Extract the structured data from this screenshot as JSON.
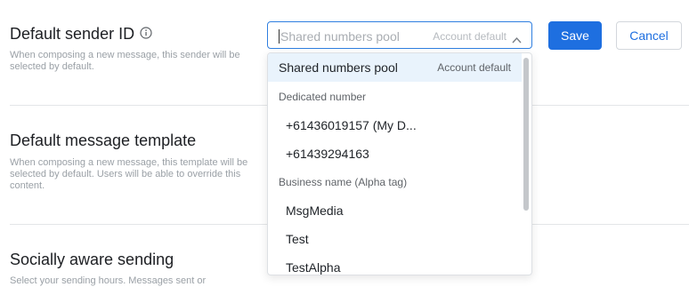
{
  "sender": {
    "title": "Default sender ID",
    "description": "When composing a new message, this sender will be selected by default.",
    "select_value": "Shared numbers pool",
    "select_tag": "Account default"
  },
  "buttons": {
    "save": "Save",
    "cancel": "Cancel"
  },
  "template": {
    "title": "Default message template",
    "description": "When composing a new message, this template will be selected by default. Users will be able to override this content."
  },
  "social": {
    "title": "Socially aware sending",
    "description": "Select your sending hours. Messages sent or"
  },
  "dropdown": {
    "options": [
      {
        "label": "Shared numbers pool",
        "tag": "Account default",
        "selected": true
      },
      {
        "group": "Dedicated number"
      },
      {
        "label": "+61436019157 (My D..."
      },
      {
        "label": "+61439294163"
      },
      {
        "group": "Business name (Alpha tag)"
      },
      {
        "label": "MsgMedia"
      },
      {
        "label": "Test"
      },
      {
        "label": "TestAlpha"
      }
    ]
  },
  "colors": {
    "accent": "#1e6fe0",
    "focus_border": "#2f7fe0",
    "selected_bg": "#e9f3fc"
  }
}
